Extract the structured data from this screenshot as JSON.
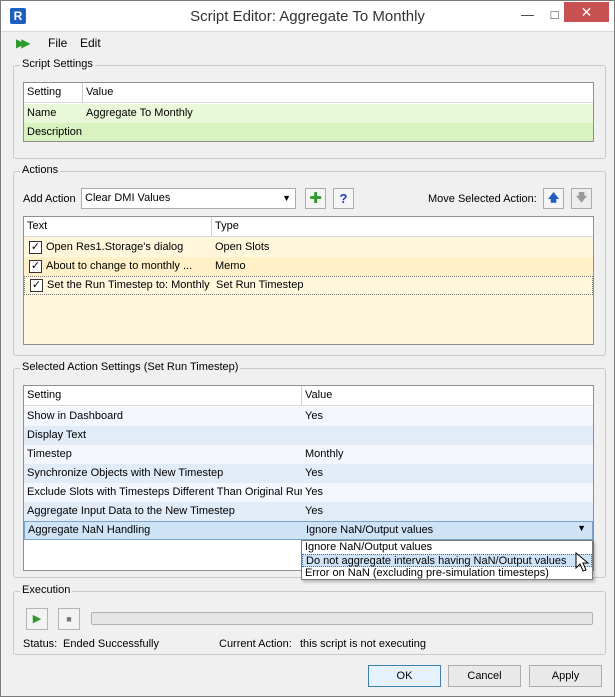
{
  "window": {
    "title": "Script Editor: Aggregate To Monthly",
    "app_icon_letter": "R"
  },
  "menu": {
    "file": "File",
    "edit": "Edit"
  },
  "script_settings": {
    "group_label": "Script Settings",
    "headers": [
      "Setting",
      "Value"
    ],
    "rows": [
      {
        "setting": "Name",
        "value": "Aggregate To Monthly"
      },
      {
        "setting": "Description",
        "value": ""
      }
    ]
  },
  "actions": {
    "group_label": "Actions",
    "add_action_label": "Add Action",
    "add_action_value": "Clear DMI Values",
    "move_label": "Move Selected Action:",
    "headers": [
      "Text",
      "Type"
    ],
    "rows": [
      {
        "checked": true,
        "text": "Open Res1.Storage's dialog",
        "type": "Open Slots"
      },
      {
        "checked": true,
        "text": "About to change to monthly ...",
        "type": "Memo"
      },
      {
        "checked": true,
        "text": "Set the Run Timestep to: Monthly",
        "type": "Set Run Timestep"
      }
    ]
  },
  "selected_action": {
    "group_label": "Selected Action Settings (Set Run Timestep)",
    "headers": [
      "Setting",
      "Value"
    ],
    "rows": [
      {
        "setting": "Show in Dashboard",
        "value": "Yes"
      },
      {
        "setting": "Display Text",
        "value": ""
      },
      {
        "setting": "Timestep",
        "value": "Monthly"
      },
      {
        "setting": "Synchronize Objects with New Timestep",
        "value": "Yes"
      },
      {
        "setting": "Exclude Slots with Timesteps Different Than Original Run",
        "value": "Yes"
      },
      {
        "setting": "Aggregate Input Data to the New Timestep",
        "value": "Yes"
      },
      {
        "setting": "Aggregate NaN Handling",
        "value": "Ignore NaN/Output values"
      }
    ],
    "dropdown_options": [
      "Ignore NaN/Output values",
      "Do not aggregate intervals having NaN/Output values",
      "Error on NaN (excluding pre-simulation timesteps)"
    ]
  },
  "execution": {
    "group_label": "Execution",
    "status_label": "Status:",
    "status_value": "Ended Successfully",
    "current_action_label": "Current Action:",
    "current_action_value": "this script is not executing",
    "progress": 0
  },
  "footer": {
    "ok": "OK",
    "cancel": "Cancel",
    "apply": "Apply"
  },
  "colors": {
    "accent": "#1f5fbf",
    "run_green": "#2e9a2e",
    "row_green": "#e8f8d8",
    "row_yellow": "#fff6dc",
    "row_blue": "#e8f0fb",
    "selected_row": "#cfe3f7"
  },
  "icons": {
    "app": "r-app-icon",
    "run": "run-icon",
    "add": "plus-icon",
    "help": "question-icon",
    "up": "arrow-up-icon",
    "down": "arrow-down-icon",
    "play": "play-icon",
    "stop": "stop-icon"
  }
}
